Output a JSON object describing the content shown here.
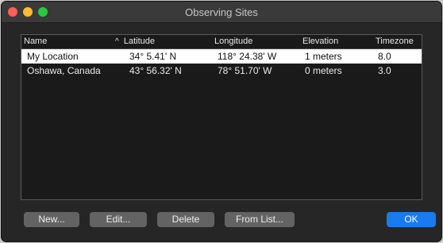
{
  "window": {
    "title": "Observing Sites"
  },
  "table": {
    "columns": [
      "Name",
      "Latitude",
      "Longitude",
      "Elevation",
      "Timezone"
    ],
    "sort_indicator": "^",
    "rows": [
      {
        "name": "My Location",
        "latitude": "34° 5.41' N",
        "longitude": "118° 24.38' W",
        "elevation": "1 meters",
        "timezone": "8.0",
        "selected": true
      },
      {
        "name": "Oshawa, Canada",
        "latitude": "43° 56.32' N",
        "longitude": "78° 51.70' W",
        "elevation": "0 meters",
        "timezone": "3.0",
        "selected": false
      }
    ]
  },
  "buttons": {
    "new": "New...",
    "edit": "Edit...",
    "delete": "Delete",
    "from_list": "From List...",
    "ok": "OK"
  },
  "colors": {
    "window_bg": "#262626",
    "selected_row": "#ffffff",
    "accent": "#1a7af0"
  }
}
